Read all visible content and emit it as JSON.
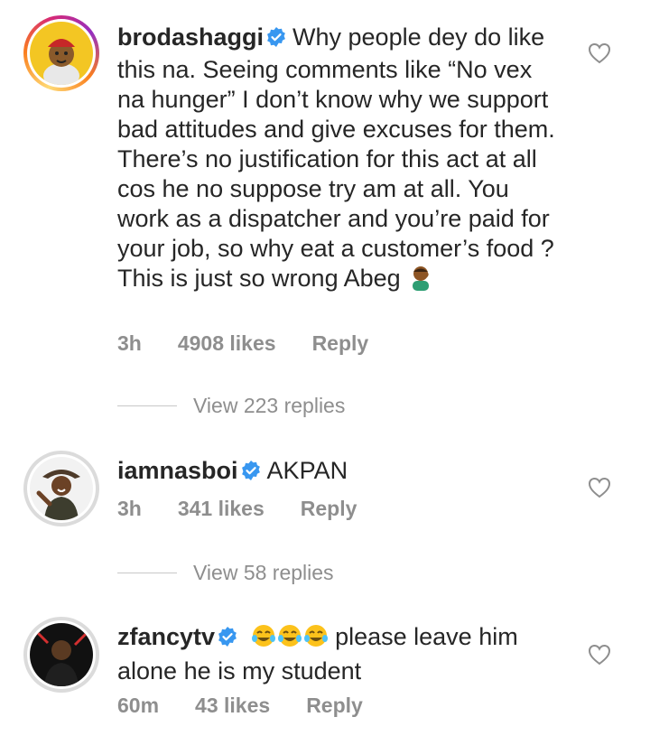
{
  "accent_color": "#3897f0",
  "comments": [
    {
      "username": "brodashaggi",
      "verified": true,
      "text": "Why people dey do like this na. Seeing comments like “No vex na hunger” I don’t know why we support bad attitudes and give excuses for them. There’s no justification for this act at all cos he no suppose try am at all. You work as a dispatcher and you’re paid for your job, so why eat a customer’s food ? This is just so wrong Abeg",
      "emoji": "man-facepalming-emoji",
      "time": "3h",
      "likes": "4908 likes",
      "reply_label": "Reply",
      "view_replies": "View 223 replies"
    },
    {
      "username": "iamnasboi",
      "verified": true,
      "text": "AKPAN",
      "time": "3h",
      "likes": "341 likes",
      "reply_label": "Reply",
      "view_replies": "View 58 replies"
    },
    {
      "username": "zfancytv",
      "verified": true,
      "emoji": "tears-of-joy-emoji x3",
      "text": "please leave him alone he is my student",
      "time": "60m",
      "likes": "43 likes",
      "reply_label": "Reply"
    }
  ]
}
